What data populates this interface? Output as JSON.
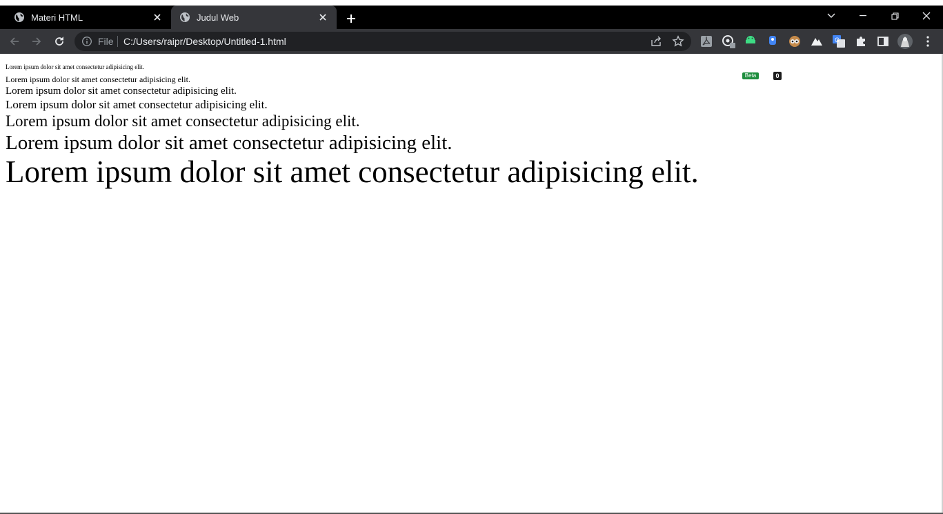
{
  "browser": {
    "tabs": [
      {
        "title": "Materi HTML",
        "active": false
      },
      {
        "title": "Judul Web",
        "active": true
      }
    ],
    "address": {
      "scheme_label": "File",
      "url": "C:/Users/raipr/Desktop/Untitled-1.html"
    },
    "extensions": [
      {
        "icon": "pdf-icon"
      },
      {
        "icon": "eyedropper-icon"
      },
      {
        "icon": "android-beta-icon",
        "badge": "Beta"
      },
      {
        "icon": "extension-counter-icon",
        "badge": "0"
      },
      {
        "icon": "owl-icon"
      },
      {
        "icon": "mountain-icon"
      },
      {
        "icon": "translate-icon"
      },
      {
        "icon": "puzzle-icon"
      },
      {
        "icon": "side-panel-icon"
      },
      {
        "icon": "profile-avatar-icon"
      },
      {
        "icon": "kebab-menu-icon"
      }
    ],
    "colors": {
      "tabstrip": "#000000",
      "toolbar": "#35363a",
      "omnibox": "#202124",
      "text": "#e8eaed"
    }
  },
  "page": {
    "lines": [
      "Lorem ipsum dolor sit amet consectetur adipisicing elit.",
      "Lorem ipsum dolor sit amet consectetur adipisicing elit.",
      "Lorem ipsum dolor sit amet consectetur adipisicing elit.",
      "Lorem ipsum dolor sit amet consectetur adipisicing elit.",
      "Lorem ipsum dolor sit amet consectetur adipisicing elit.",
      "Lorem ipsum dolor sit amet consectetur adipisicing elit.",
      "Lorem ipsum dolor sit amet consectetur adipisicing elit."
    ]
  }
}
